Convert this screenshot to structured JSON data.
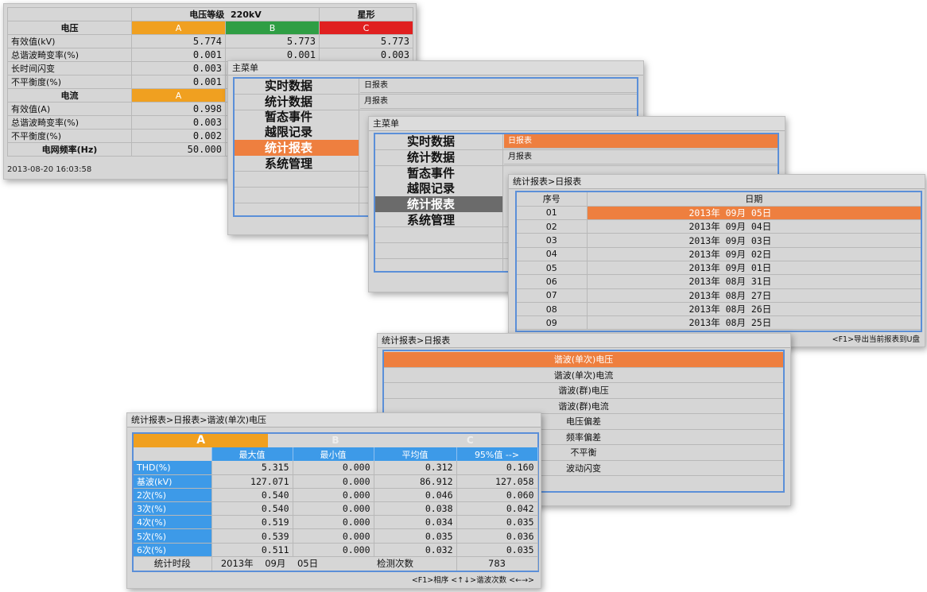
{
  "panel1": {
    "header": {
      "label": "电压等级",
      "voltage": "220kV",
      "wiring": "星形"
    },
    "voltage_title": "电压",
    "phases": [
      "A",
      "B",
      "C"
    ],
    "voltage_rows": [
      {
        "label": "有效值(kV)",
        "a": "5.774",
        "b": "5.773",
        "c": "5.773"
      },
      {
        "label": "总谐波畸变率(%)",
        "a": "0.001",
        "b": "0.001",
        "c": "0.003"
      },
      {
        "label": "长时间闪变",
        "a": "0.003"
      },
      {
        "label": "不平衡度(%)",
        "a": "0.001"
      }
    ],
    "current_title": "电流",
    "current_phase": "A",
    "current_rows": [
      {
        "label": "有效值(A)",
        "a": "0.998"
      },
      {
        "label": "总谐波畸变率(%)",
        "a": "0.003"
      },
      {
        "label": "不平衡度(%)",
        "a": "0.002"
      }
    ],
    "freq_label": "电网频率(Hz)",
    "freq_value": "50.000",
    "timestamp": "2013-08-20 16:03:58"
  },
  "menu_panel_a": {
    "title": "主菜单",
    "items": [
      "实时数据",
      "统计数据",
      "暂态事件",
      "越限记录",
      "统计报表",
      "系统管理"
    ],
    "selected_index": 4,
    "submenu": [
      "日报表",
      "月报表"
    ]
  },
  "menu_panel_b": {
    "title": "主菜单",
    "items": [
      "实时数据",
      "统计数据",
      "暂态事件",
      "越限记录",
      "统计报表",
      "系统管理"
    ],
    "selected_index": 4,
    "submenu": [
      "日报表",
      "月报表"
    ],
    "submenu_selected_index": 0
  },
  "date_list": {
    "title": "统计报表>日报表",
    "col_index": "序号",
    "col_date": "日期",
    "rows": [
      {
        "idx": "01",
        "date": "2013年  09月  05日"
      },
      {
        "idx": "02",
        "date": "2013年  09月  04日"
      },
      {
        "idx": "03",
        "date": "2013年  09月  03日"
      },
      {
        "idx": "04",
        "date": "2013年  09月  02日"
      },
      {
        "idx": "05",
        "date": "2013年  09月  01日"
      },
      {
        "idx": "06",
        "date": "2013年  08月  31日"
      },
      {
        "idx": "07",
        "date": "2013年  08月  27日"
      },
      {
        "idx": "08",
        "date": "2013年  08月  26日"
      },
      {
        "idx": "09",
        "date": "2013年  08月  25日"
      }
    ],
    "selected_index": 0,
    "footer": "<F1>导出当前报表到U盘"
  },
  "report_menu": {
    "title": "统计报表>日报表",
    "options": [
      "谐波(单次)电压",
      "谐波(单次)电流",
      "谐波(群)电压",
      "谐波(群)电流",
      "电压偏差",
      "频率偏差",
      "不平衡",
      "波动闪变"
    ],
    "selected_index": 0
  },
  "harmonic_table": {
    "title": "统计报表>日报表>谐波(单次)电压",
    "phases": [
      "A",
      "B",
      "C"
    ],
    "active_phase": "A",
    "columns": [
      "最大值",
      "最小值",
      "平均值",
      "95%值 -->"
    ],
    "rows": [
      {
        "label": "THD(%)",
        "max": "5.315",
        "min": "0.000",
        "avg": "0.312",
        "p95": "0.160"
      },
      {
        "label": "基波(kV)",
        "max": "127.071",
        "min": "0.000",
        "avg": "86.912",
        "p95": "127.058"
      },
      {
        "label": "2次(%)",
        "max": "0.540",
        "min": "0.000",
        "avg": "0.046",
        "p95": "0.060"
      },
      {
        "label": "3次(%)",
        "max": "0.540",
        "min": "0.000",
        "avg": "0.038",
        "p95": "0.042"
      },
      {
        "label": "4次(%)",
        "max": "0.519",
        "min": "0.000",
        "avg": "0.034",
        "p95": "0.035"
      },
      {
        "label": "5次(%)",
        "max": "0.539",
        "min": "0.000",
        "avg": "0.035",
        "p95": "0.036"
      },
      {
        "label": "6次(%)",
        "max": "0.511",
        "min": "0.000",
        "avg": "0.032",
        "p95": "0.035"
      }
    ],
    "period_label": "统计时段",
    "period_year": "2013年",
    "period_month": "09月",
    "period_day": "05日",
    "count_label": "检测次数",
    "count_value": "783",
    "footer": "<F1>相序  <↑↓>谐波次数  <←→>"
  }
}
